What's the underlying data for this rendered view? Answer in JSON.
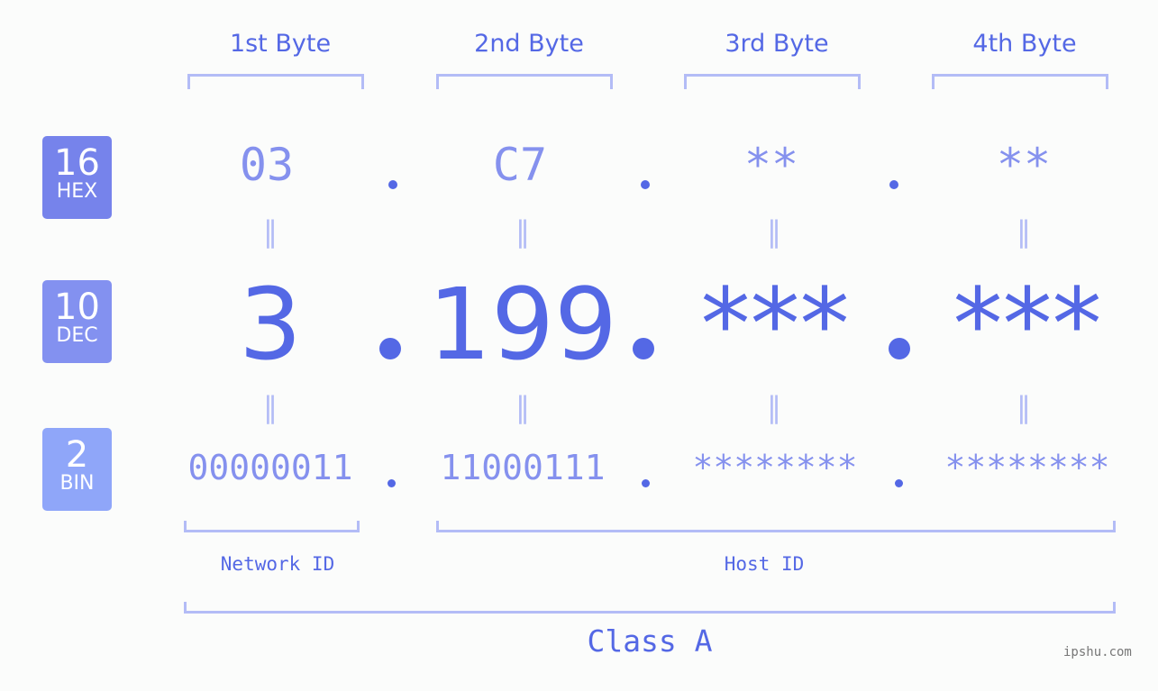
{
  "headers": [
    "1st Byte",
    "2nd Byte",
    "3rd Byte",
    "4th Byte"
  ],
  "badges": [
    {
      "num": "16",
      "label": "HEX",
      "color": "#7683eb"
    },
    {
      "num": "10",
      "label": "DEC",
      "color": "#8391f0"
    },
    {
      "num": "2",
      "label": "BIN",
      "color": "#8fa6f9"
    }
  ],
  "hex": [
    "03",
    "C7",
    "**",
    "**"
  ],
  "dec": [
    "3",
    "199",
    "***",
    "***"
  ],
  "bin": [
    "00000011",
    "11000111",
    "********",
    "********"
  ],
  "equals": "=",
  "network_label": "Network ID",
  "host_label": "Host ID",
  "class_label": "Class A",
  "watermark": "ipshu.com"
}
